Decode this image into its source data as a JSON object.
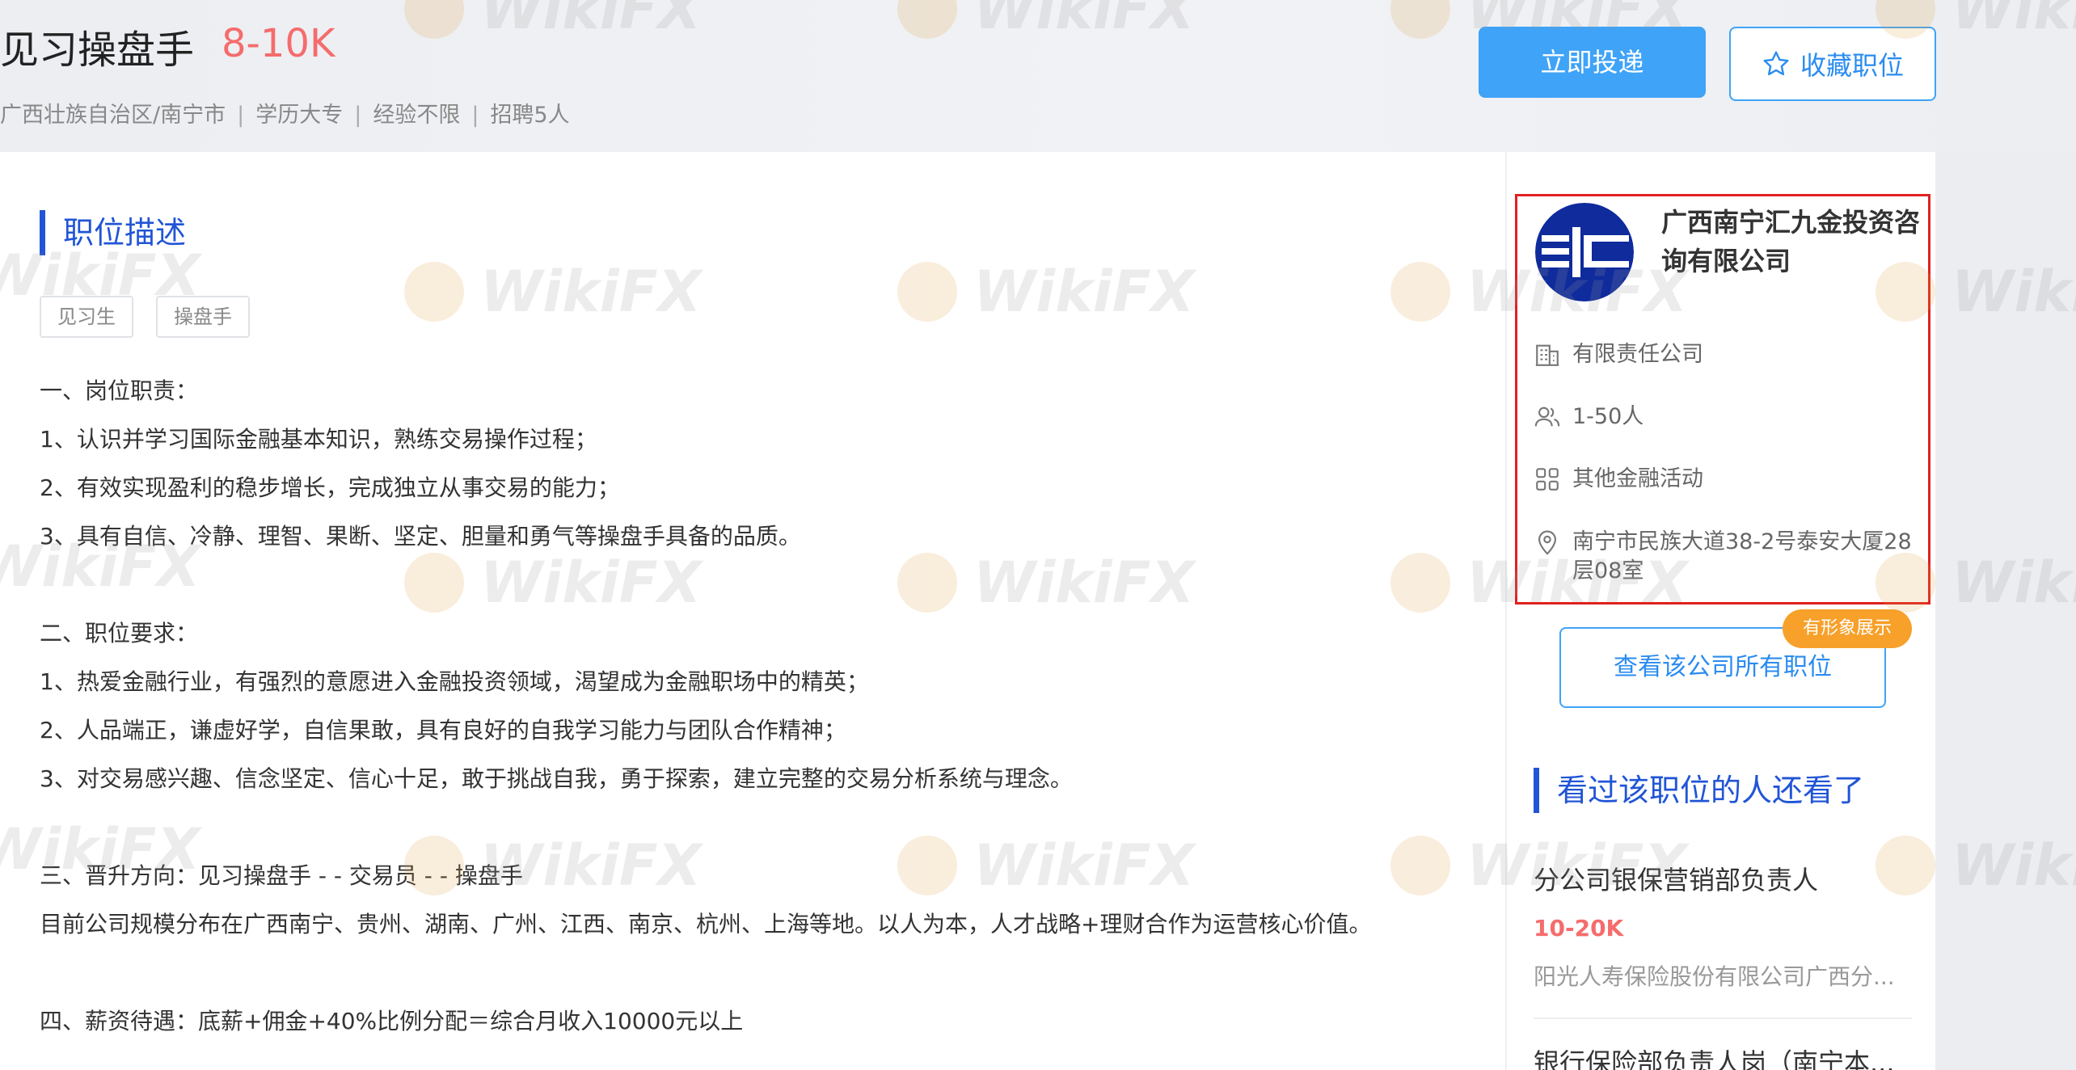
{
  "job": {
    "title": "见习操盘手",
    "salary": "8-10K",
    "meta": [
      "广西壮族自治区/南宁市",
      "学历大专",
      "经验不限",
      "招聘5人"
    ],
    "separator": "|"
  },
  "actions": {
    "apply_label": "立即投递",
    "favorite_label": "收藏职位"
  },
  "description": {
    "section_title": "职位描述",
    "tags": [
      "见习生",
      "操盘手"
    ],
    "lines": [
      "一、岗位职责：",
      "1、认识并学习国际金融基本知识，熟练交易操作过程；",
      "2、有效实现盈利的稳步增长，完成独立从事交易的能力；",
      "3、具有自信、冷静、理智、果断、坚定、胆量和勇气等操盘手具备的品质。",
      "二、职位要求：",
      "1、热爱金融行业，有强烈的意愿进入金融投资领域，渴望成为金融职场中的精英；",
      "2、人品端正，谦虚好学，自信果敢，具有良好的自我学习能力与团队合作精神；",
      "3、对交易感兴趣、信念坚定、信心十足，敢于挑战自我，勇于探索，建立完整的交易分析系统与理念。",
      "三、晋升方向：见习操盘手 - - 交易员 - - 操盘手",
      "目前公司规模分布在广西南宁、贵州、湖南、广州、江西、南京、杭州、上海等地。以人为本，人才战略+理财合作为运营核心价值。",
      "四、薪资待遇：底薪+佣金+40%比例分配＝综合月收入10000元以上"
    ]
  },
  "company": {
    "name": "广西南宁汇九金投资咨询有限公司",
    "type": "有限责任公司",
    "size": "1-50人",
    "industry": "其他金融活动",
    "address": "南宁市民族大道38-2号泰安大厦28层08室",
    "see_all_label": "查看该公司所有职位",
    "image_badge": "有形象展示",
    "logo_color": "#0f2b9c",
    "icons": [
      "building-icon",
      "people-icon",
      "grid-icon",
      "location-pin-icon"
    ]
  },
  "related": {
    "section_title": "看过该职位的人还看了",
    "items": [
      {
        "title": "分公司银保营销部负责人",
        "salary": "10-20K",
        "company": "阳光人寿保险股份有限公司广西分..."
      },
      {
        "title": "银行保险部负责人岗（南宁本..."
      }
    ]
  },
  "watermark": "WikiFX",
  "colors": {
    "accent_blue": "#3fa3f7",
    "title_blue": "#2155d6",
    "salary_red": "#f56c6c",
    "highlight_red": "#e02020",
    "badge_orange": "#f7a02a"
  }
}
